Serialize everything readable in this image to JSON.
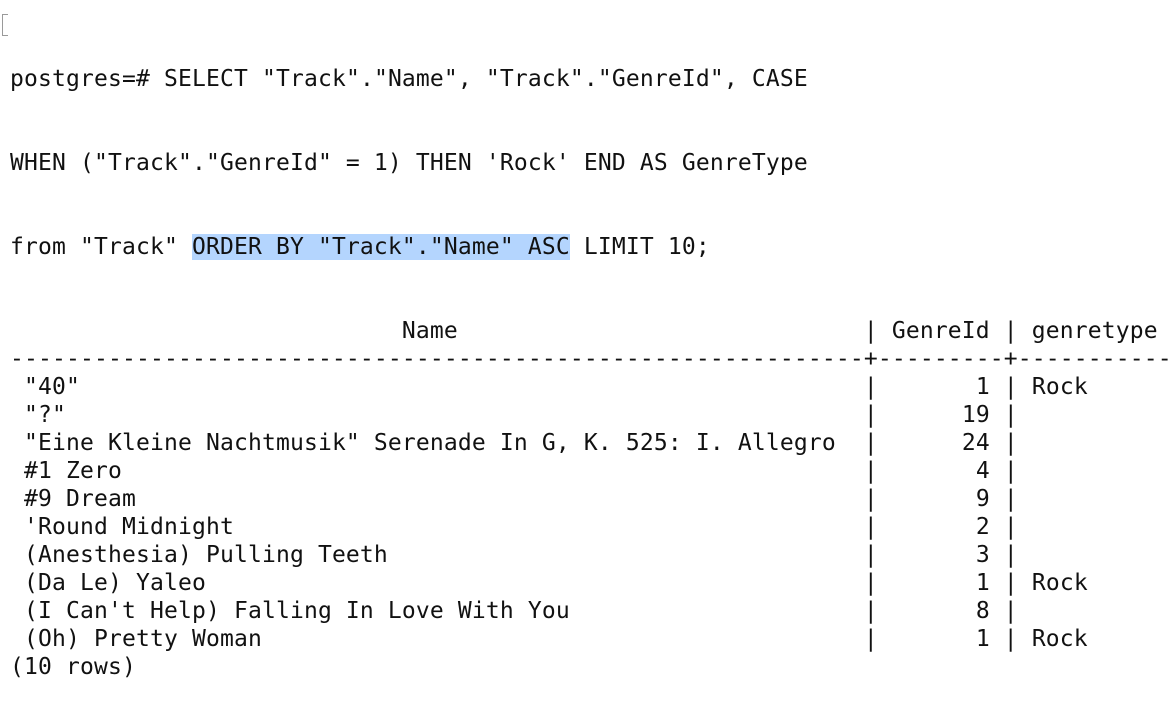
{
  "prompt": "postgres=# ",
  "query": {
    "line1": "SELECT \"Track\".\"Name\", \"Track\".\"GenreId\", CASE",
    "line2": "WHEN (\"Track\".\"GenreId\" = 1) THEN 'Rock' END AS GenreType",
    "line3_pre": "from \"Track\" ",
    "line3_selected": "ORDER BY \"Track\".\"Name\" ASC",
    "line3_post": " LIMIT 10;"
  },
  "table": {
    "columns": [
      "Name",
      "GenreId",
      "genretype"
    ],
    "rows": [
      {
        "name": "\"40\"",
        "genreid": "1",
        "genretype": "Rock"
      },
      {
        "name": "\"?\"",
        "genreid": "19",
        "genretype": ""
      },
      {
        "name": "\"Eine Kleine Nachtmusik\" Serenade In G, K. 525: I. Allegro",
        "genreid": "24",
        "genretype": ""
      },
      {
        "name": "#1 Zero",
        "genreid": "4",
        "genretype": ""
      },
      {
        "name": "#9 Dream",
        "genreid": "9",
        "genretype": ""
      },
      {
        "name": "'Round Midnight",
        "genreid": "2",
        "genretype": ""
      },
      {
        "name": "(Anesthesia) Pulling Teeth",
        "genreid": "3",
        "genretype": ""
      },
      {
        "name": "(Da Le) Yaleo",
        "genreid": "1",
        "genretype": "Rock"
      },
      {
        "name": "(I Can't Help) Falling In Love With You",
        "genreid": "8",
        "genretype": ""
      },
      {
        "name": "(Oh) Pretty Woman",
        "genreid": "1",
        "genretype": "Rock"
      }
    ],
    "footer": "(10 rows)"
  }
}
